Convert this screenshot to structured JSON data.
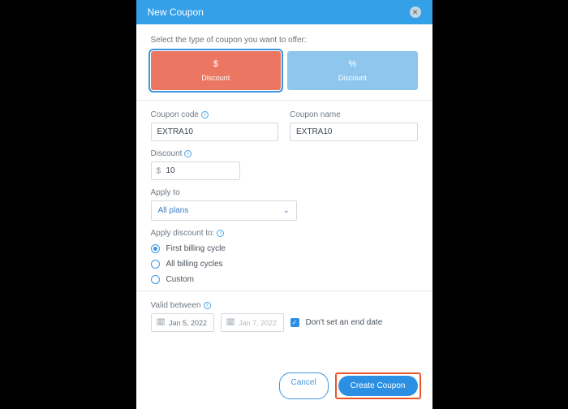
{
  "header": {
    "title": "New Coupon"
  },
  "intro": "Select the type of coupon you want to offer:",
  "types": {
    "dollar": {
      "symbol": "$",
      "label": "Discount"
    },
    "percent": {
      "symbol": "%",
      "label": "Discount"
    }
  },
  "fields": {
    "code_label": "Coupon code",
    "code_value": "EXTRA10",
    "name_label": "Coupon name",
    "name_value": "EXTRA10",
    "discount_label": "Discount",
    "discount_prefix": "$",
    "discount_value": "10",
    "apply_to_label": "Apply to",
    "apply_to_value": "All plans",
    "apply_discount_label": "Apply discount to:",
    "radio": {
      "first": "First billing cycle",
      "all": "All billing cycles",
      "custom": "Custom"
    },
    "valid_label": "Valid between",
    "date_start": "Jan 5, 2022",
    "date_end": "Jan 7, 2022",
    "no_end_label": "Don't set an end date"
  },
  "footer": {
    "cancel": "Cancel",
    "create": "Create Coupon"
  }
}
